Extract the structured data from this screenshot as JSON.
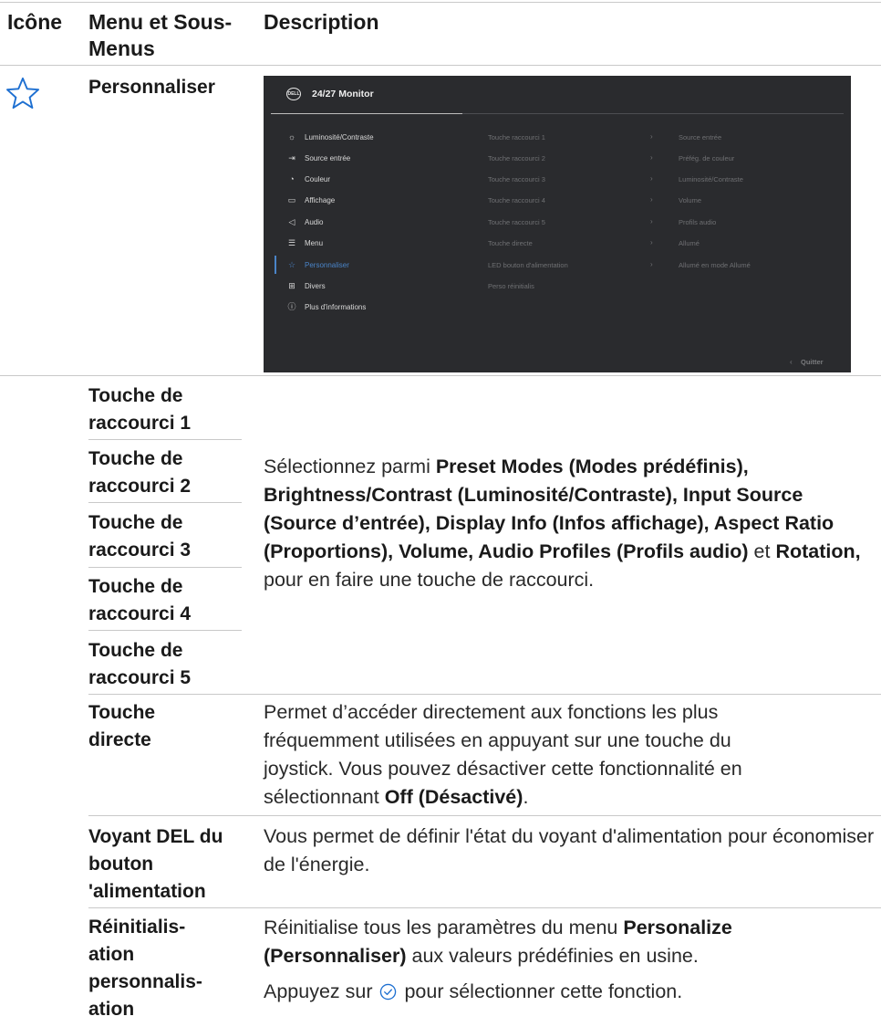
{
  "header": {
    "col_icon": "Icône",
    "col_menu": "Menu et Sous-Menus",
    "col_desc": "Description"
  },
  "section": {
    "icon": "star-icon",
    "title": "Personnaliser"
  },
  "osd": {
    "logo": "DELL",
    "title": "24/27 Monitor",
    "menu": [
      {
        "icon": "sun-icon",
        "label": "Luminosité/Contraste"
      },
      {
        "icon": "input-icon",
        "label": "Source entrée"
      },
      {
        "icon": "palette-icon",
        "label": "Couleur"
      },
      {
        "icon": "display-icon",
        "label": "Affichage"
      },
      {
        "icon": "speaker-icon",
        "label": "Audio"
      },
      {
        "icon": "menu-icon",
        "label": "Menu"
      },
      {
        "icon": "star-icon",
        "label": "Personnaliser",
        "selected": true
      },
      {
        "icon": "others-icon",
        "label": "Divers"
      },
      {
        "icon": "info-icon",
        "label": "Plus d'informations"
      }
    ],
    "submenu": [
      {
        "label": "Touche raccourci 1",
        "value": "Source entrée"
      },
      {
        "label": "Touche raccourci 2",
        "value": "Préfég. de couleur"
      },
      {
        "label": "Touche raccourci 3",
        "value": "Luminosité/Contraste"
      },
      {
        "label": "Touche raccourci 4",
        "value": "Volume"
      },
      {
        "label": "Touche raccourci 5",
        "value": "Profils audio"
      },
      {
        "label": "Touche directe",
        "value": "Allumé"
      },
      {
        "label": "LED bouton d'alimentation",
        "value": "Allumé en mode Allumé"
      },
      {
        "label": "Perso réinitialis",
        "value": ""
      }
    ],
    "quit": "Quitter",
    "accent": "#4a84c8"
  },
  "rows": {
    "shortcut_labels": [
      "Touche de raccourci 1",
      "Touche de raccourci 2",
      "Touche de raccourci 3",
      "Touche de raccourci 4",
      "Touche de raccourci 5"
    ],
    "shortcut_desc": {
      "intro": "Sélectionnez parmi ",
      "b1": "Preset Modes (Modes prédéfinis), Brightness/Contrast (Luminosité/Contraste), Input Source (Source d’entrée), Display Info (Infos affichage), Aspect Ratio (Proportions), Volume, Audio Profiles (Profils audio)",
      "mid": " et ",
      "b2": "Rotation,",
      "end": " pour en faire une touche de raccourci."
    },
    "direct_label": "Touche directe",
    "direct_desc": {
      "text": "Permet d’accéder directement aux fonctions les plus fréquemment utilisées en appuyant sur une touche du joystick. Vous pouvez désactiver cette fonctionnalité en sélectionnant ",
      "bold": "Off (Désactivé)",
      "end": "."
    },
    "led_label": "Voyant DEL du bouton 'alimentation",
    "led_desc": "Vous permet de définir l'état du voyant d'alimentation pour économiser de l'énergie.",
    "reset_label": "Réinitialis-ation personnalis-ation",
    "reset_desc": {
      "text": "Réinitialise tous les paramètres du menu ",
      "bold": "Personalize (Personnaliser)",
      "end": " aux valeurs prédéfinies en usine.",
      "line2_pre": "Appuyez sur ",
      "line2_icon": "check-circle-icon",
      "line2_post": " pour sélectionner cette fonction."
    }
  }
}
